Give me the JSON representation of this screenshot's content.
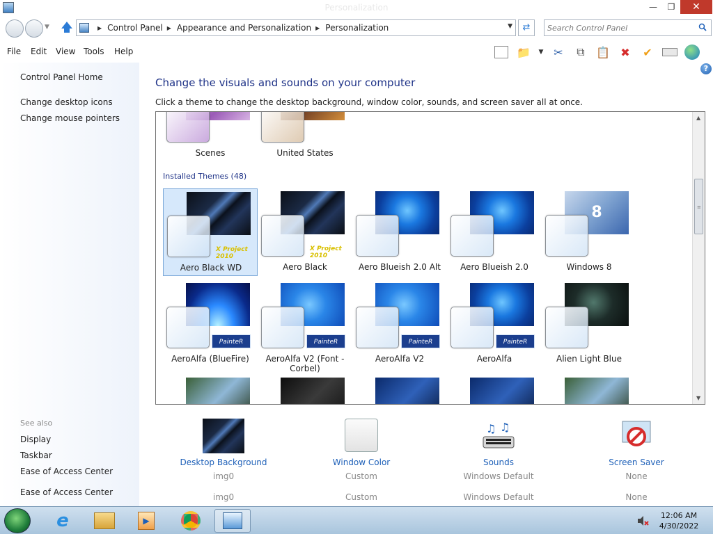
{
  "window": {
    "title": "Personalization"
  },
  "breadcrumbs": [
    "Control Panel",
    "Appearance and Personalization",
    "Personalization"
  ],
  "search": {
    "placeholder": "Search Control Panel"
  },
  "menu": [
    "File",
    "Edit",
    "View",
    "Tools",
    "Help"
  ],
  "left_pane": {
    "links": [
      "Control Panel Home",
      "Change desktop icons",
      "Change mouse pointers"
    ],
    "see_also_label": "See also",
    "see_also": [
      "Display",
      "Taskbar",
      "Ease of Access Center",
      "Ease of Access Center"
    ]
  },
  "main": {
    "title": "Change the visuals and sounds on your computer",
    "subtitle": "Click a theme to change the desktop background, window color, sounds, and screen saver all at once.",
    "top_themes": [
      "Scenes",
      "United States"
    ],
    "installed_label": "Installed Themes (48)",
    "themes_row1": [
      "Aero Black WD",
      "Aero Black",
      "Aero Blueish 2.0 Alt",
      "Aero Blueish 2.0",
      "Windows 8"
    ],
    "themes_row2": [
      "AeroAlfa (BlueFire)",
      "AeroAlfa V2 (Font - Corbel)",
      "AeroAlfa V2",
      "AeroAlfa",
      "Alien Light Blue"
    ],
    "badge_text": "PainteR",
    "xproject_text": "X Project 2010",
    "win8_digit": "8"
  },
  "options": [
    {
      "label": "Desktop Background",
      "value": "img0",
      "value2": "img0"
    },
    {
      "label": "Window Color",
      "value": "Custom",
      "value2": "Custom"
    },
    {
      "label": "Sounds",
      "value": "Windows Default",
      "value2": "Windows Default"
    },
    {
      "label": "Screen Saver",
      "value": "None",
      "value2": "None"
    }
  ],
  "taskbar": {
    "time": "12:06 AM",
    "date": "4/30/2022"
  },
  "colors": {
    "link": "#1e60b8",
    "title": "#1e3287",
    "close_red": "#c0392b"
  }
}
